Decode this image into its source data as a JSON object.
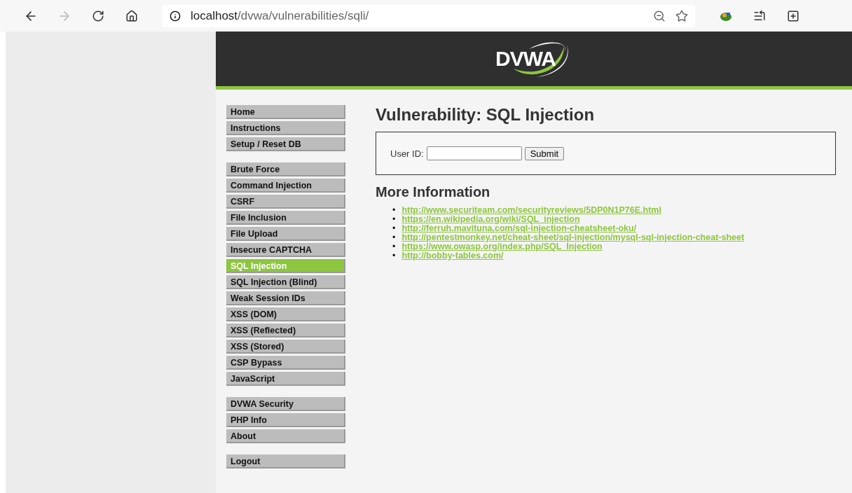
{
  "browser": {
    "url_host": "localhost",
    "url_path": "/dvwa/vulnerabilities/sqli/"
  },
  "header": {
    "logo": "DVWA"
  },
  "menu": [
    [
      {
        "label": "Home",
        "selected": false
      },
      {
        "label": "Instructions",
        "selected": false
      },
      {
        "label": "Setup / Reset DB",
        "selected": false
      }
    ],
    [
      {
        "label": "Brute Force",
        "selected": false
      },
      {
        "label": "Command Injection",
        "selected": false
      },
      {
        "label": "CSRF",
        "selected": false
      },
      {
        "label": "File Inclusion",
        "selected": false
      },
      {
        "label": "File Upload",
        "selected": false
      },
      {
        "label": "Insecure CAPTCHA",
        "selected": false
      },
      {
        "label": "SQL Injection",
        "selected": true
      },
      {
        "label": "SQL Injection (Blind)",
        "selected": false
      },
      {
        "label": "Weak Session IDs",
        "selected": false
      },
      {
        "label": "XSS (DOM)",
        "selected": false
      },
      {
        "label": "XSS (Reflected)",
        "selected": false
      },
      {
        "label": "XSS (Stored)",
        "selected": false
      },
      {
        "label": "CSP Bypass",
        "selected": false
      },
      {
        "label": "JavaScript",
        "selected": false
      }
    ],
    [
      {
        "label": "DVWA Security",
        "selected": false
      },
      {
        "label": "PHP Info",
        "selected": false
      },
      {
        "label": "About",
        "selected": false
      }
    ],
    [
      {
        "label": "Logout",
        "selected": false
      }
    ]
  ],
  "main": {
    "title": "Vulnerability: SQL Injection",
    "form": {
      "label": "User ID:",
      "button": "Submit"
    },
    "more_title": "More Information",
    "links": [
      {
        "bullet": "•",
        "url": "http://www.securiteam.com/securityreviews/5DP0N1P76E.html"
      },
      {
        "bullet": "•",
        "url": "https://en.wikipedia.org/wiki/SQL_injection"
      },
      {
        "bullet": "•",
        "url": "http://ferruh.mavituna.com/sql-injection-cheatsheet-oku/"
      },
      {
        "bullet": "•",
        "url": "http://pentestmonkey.net/cheat-sheet/sql-injection/mysql-sql-injection-cheat-sheet"
      },
      {
        "bullet": "•",
        "url": "https://www.owasp.org/index.php/SQL_Injection"
      },
      {
        "bullet": "•",
        "url": "http://bobby-tables.com/"
      }
    ]
  }
}
